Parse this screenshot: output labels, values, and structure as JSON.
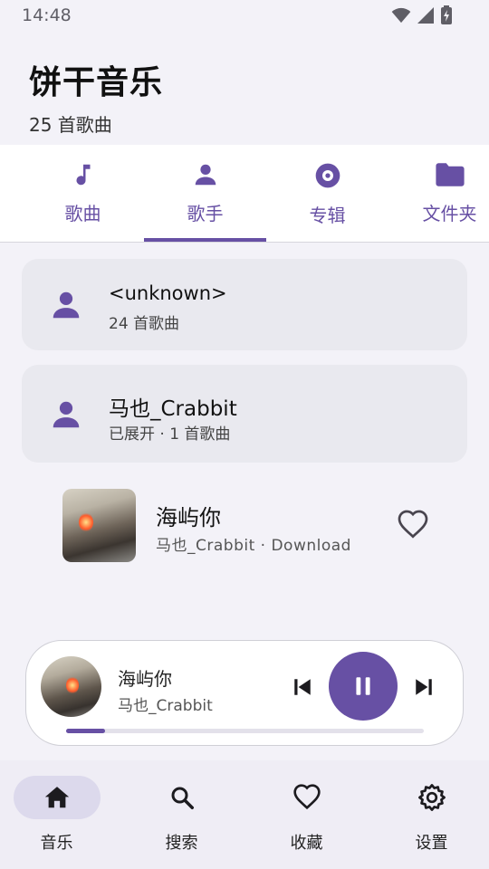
{
  "status_bar": {
    "time": "14:48"
  },
  "header": {
    "title": "饼干音乐",
    "subtitle": "25 首歌曲"
  },
  "tabs": [
    {
      "label": "歌曲",
      "icon": "music-note-icon"
    },
    {
      "label": "歌手",
      "icon": "person-icon",
      "selected": true
    },
    {
      "label": "专辑",
      "icon": "album-icon"
    },
    {
      "label": "文件夹",
      "icon": "folder-icon"
    }
  ],
  "artists": [
    {
      "name": "<unknown>",
      "meta": "24 首歌曲"
    },
    {
      "name": "马也_Crabbit",
      "meta": "已展开 · 1 首歌曲"
    }
  ],
  "songs": [
    {
      "title": "海屿你",
      "meta": "马也_Crabbit · Download",
      "favorite": false
    }
  ],
  "player": {
    "title": "海屿你",
    "artist": "马也_Crabbit",
    "state": "playing",
    "progress": 0.11
  },
  "bottom_nav": [
    {
      "label": "音乐",
      "icon": "home-icon",
      "active": true
    },
    {
      "label": "搜索",
      "icon": "search-icon"
    },
    {
      "label": "收藏",
      "icon": "heart-icon"
    },
    {
      "label": "设置",
      "icon": "settings-icon"
    }
  ],
  "colors": {
    "accent": "#6750a4",
    "background": "#f3f2f8",
    "card": "#e9e9ef",
    "nav_active": "#dcd9ec"
  }
}
